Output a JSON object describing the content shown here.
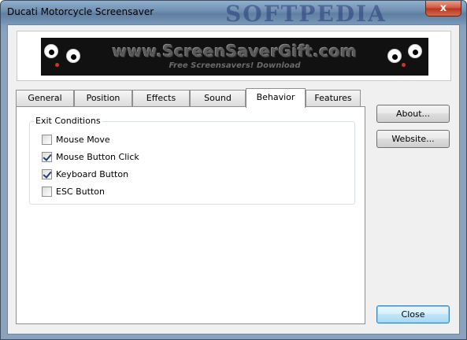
{
  "window": {
    "title": "Ducati Motorcycle Screensaver",
    "watermark": "SOFTPEDIA",
    "close_glyph": "x"
  },
  "banner": {
    "url_text": "www.ScreenSaverGift.com",
    "sub_text": "Free Screensavers! Download"
  },
  "tabs": [
    {
      "label": "General",
      "active": false
    },
    {
      "label": "Position",
      "active": false
    },
    {
      "label": "Effects",
      "active": false
    },
    {
      "label": "Sound",
      "active": false
    },
    {
      "label": "Behavior",
      "active": true
    },
    {
      "label": "Features",
      "active": false
    }
  ],
  "behavior": {
    "group_title": "Exit Conditions",
    "options": [
      {
        "label": "Mouse Move",
        "checked": false
      },
      {
        "label": "Mouse Button Click",
        "checked": true
      },
      {
        "label": "Keyboard Button",
        "checked": true
      },
      {
        "label": "ESC Button",
        "checked": false
      }
    ]
  },
  "buttons": {
    "about": "About...",
    "website": "Website...",
    "close": "Close"
  },
  "colors": {
    "frame": "#8aa2bb",
    "client_bg": "#f0f0f0",
    "close_button_red": "#c84a32",
    "default_button_blue": "#bee6fd"
  }
}
